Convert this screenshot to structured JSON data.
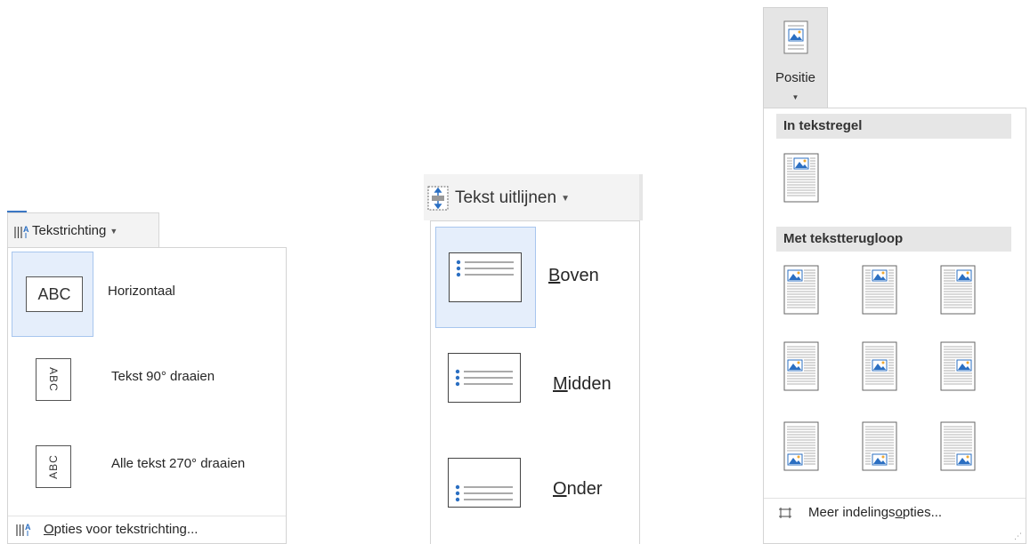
{
  "tekstrichting": {
    "button_label": "Tekstrichting",
    "options": [
      {
        "label": "Horizontaal",
        "preview": "ABC",
        "selected": true
      },
      {
        "label": "Tekst 90° draaien",
        "preview": "ABC",
        "selected": false
      },
      {
        "label": "Alle tekst 270° draaien",
        "preview": "ABC",
        "selected": false
      }
    ],
    "footer": {
      "access_key": "O",
      "rest": "pties voor tekstrichting..."
    }
  },
  "tekst_uitlijnen": {
    "button_label": "Tekst uitlijnen",
    "options": [
      {
        "access_key": "B",
        "rest": "oven",
        "selected": true
      },
      {
        "access_key": "M",
        "rest": "idden",
        "selected": false
      },
      {
        "access_key": "O",
        "rest": "nder",
        "selected": false
      }
    ]
  },
  "positie": {
    "button_label": "Positie",
    "section_inline": "In tekstregel",
    "section_wrap": "Met tekstterugloop",
    "footer": {
      "before": "Meer indelings",
      "access_key": "o",
      "after": "pties..."
    }
  },
  "colors": {
    "selection_fill": "#e5eefb",
    "selection_border": "#a8c6ee",
    "image_icon": "#2b6fc2"
  }
}
